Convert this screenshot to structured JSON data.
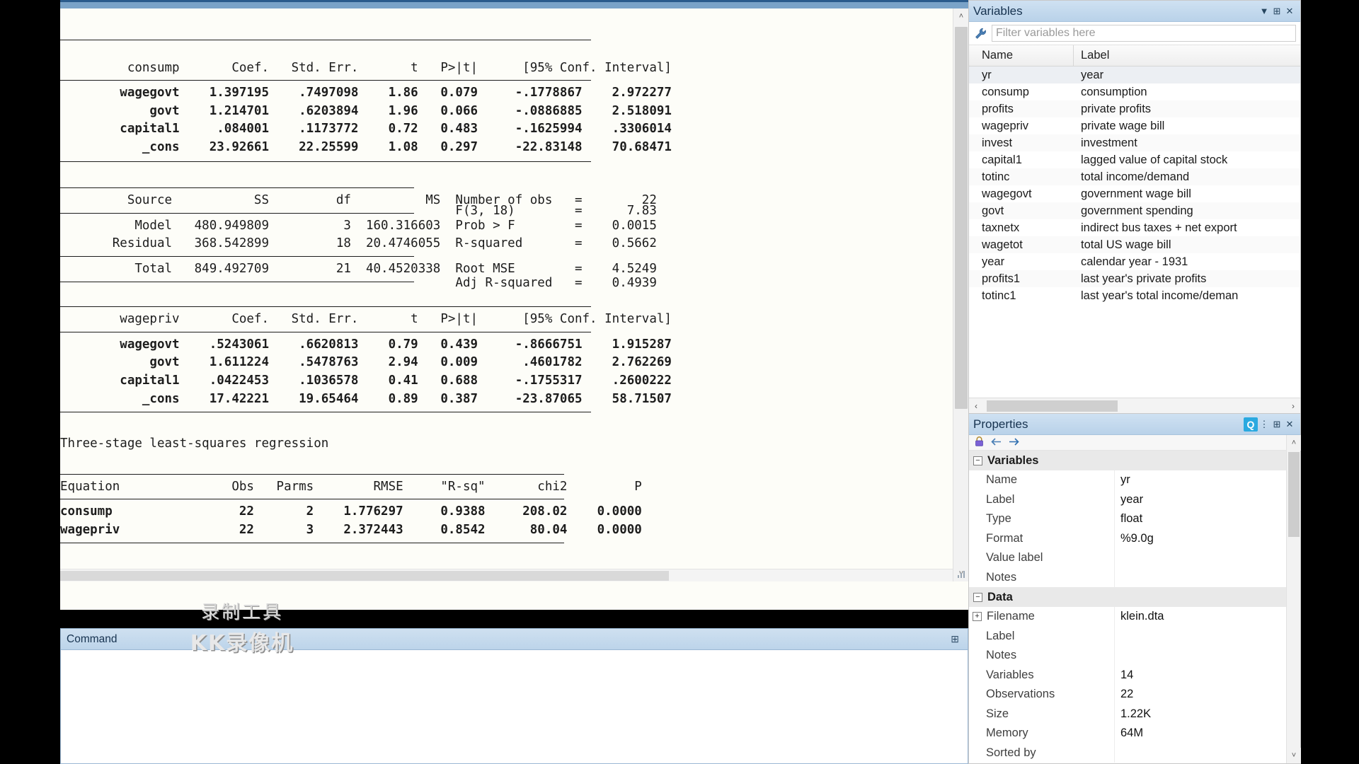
{
  "results": {
    "consump_table": {
      "dep_var": "consump",
      "columns": [
        "Coef.",
        "Std. Err.",
        "t",
        "P>|t|",
        "[95% Conf. Interval]"
      ],
      "rows": [
        {
          "term": "wagegovt",
          "coef": "1.397195",
          "se": ".7497098",
          "t": "1.86",
          "p": "0.079",
          "ci_low": "-.1778867",
          "ci_high": "2.972277"
        },
        {
          "term": "govt",
          "coef": "1.214701",
          "se": ".6203894",
          "t": "1.96",
          "p": "0.066",
          "ci_low": "-.0886885",
          "ci_high": "2.518091"
        },
        {
          "term": "capital1",
          "coef": ".084001",
          "se": ".1173772",
          "t": "0.72",
          "p": "0.483",
          "ci_low": "-.1625994",
          "ci_high": ".3306014"
        },
        {
          "term": "_cons",
          "coef": "23.92661",
          "se": "22.25599",
          "t": "1.08",
          "p": "0.297",
          "ci_low": "-22.83148",
          "ci_high": "70.68471"
        }
      ]
    },
    "anova_table": {
      "columns": [
        "Source",
        "SS",
        "df",
        "MS"
      ],
      "rows": [
        {
          "source": "Model",
          "ss": "480.949809",
          "df": "3",
          "ms": "160.316603"
        },
        {
          "source": "Residual",
          "ss": "368.542899",
          "df": "18",
          "ms": "20.4746055"
        },
        {
          "source": "Total",
          "ss": "849.492709",
          "df": "21",
          "ms": "40.4520338"
        }
      ],
      "stats": [
        {
          "label": "Number of obs",
          "eq": "=",
          "value": "22"
        },
        {
          "label": "F(3, 18)",
          "eq": "=",
          "value": "7.83"
        },
        {
          "label": "Prob > F",
          "eq": "=",
          "value": "0.0015"
        },
        {
          "label": "R-squared",
          "eq": "=",
          "value": "0.5662"
        },
        {
          "label": "Adj R-squared",
          "eq": "=",
          "value": "0.4939"
        },
        {
          "label": "Root MSE",
          "eq": "=",
          "value": "4.5249"
        }
      ]
    },
    "wagepriv_table": {
      "dep_var": "wagepriv",
      "columns": [
        "Coef.",
        "Std. Err.",
        "t",
        "P>|t|",
        "[95% Conf. Interval]"
      ],
      "rows": [
        {
          "term": "wagegovt",
          "coef": ".5243061",
          "se": ".6620813",
          "t": "0.79",
          "p": "0.439",
          "ci_low": "-.8666751",
          "ci_high": "1.915287"
        },
        {
          "term": "govt",
          "coef": "1.611224",
          "se": ".5478763",
          "t": "2.94",
          "p": "0.009",
          "ci_low": ".4601782",
          "ci_high": "2.762269"
        },
        {
          "term": "capital1",
          "coef": ".0422453",
          "se": ".1036578",
          "t": "0.41",
          "p": "0.688",
          "ci_low": "-.1755317",
          "ci_high": ".2600222"
        },
        {
          "term": "_cons",
          "coef": "17.42221",
          "se": "19.65464",
          "t": "0.89",
          "p": "0.387",
          "ci_low": "-23.87065",
          "ci_high": "58.71507"
        }
      ]
    },
    "reg3_title": "Three-stage least-squares regression",
    "reg3_table": {
      "columns": [
        "Equation",
        "Obs",
        "Parms",
        "RMSE",
        "\"R-sq\"",
        "chi2",
        "P"
      ],
      "rows": [
        {
          "equation": "consump",
          "obs": "22",
          "parms": "2",
          "rmse": "1.776297",
          "rsq": "0.9388",
          "chi2": "208.02",
          "p": "0.0000"
        },
        {
          "equation": "wagepriv",
          "obs": "22",
          "parms": "3",
          "rmse": "2.372443",
          "rsq": "0.8542",
          "chi2": "80.04",
          "p": "0.0000"
        }
      ]
    }
  },
  "command": {
    "title": "Command",
    "pin_icon": "pin-icon",
    "value": "",
    "placeholder": ""
  },
  "watermark": {
    "line1": "录制工具",
    "line2": "KK录像机"
  },
  "variables": {
    "title": "Variables",
    "title_buttons": [
      {
        "name": "filter-dropdown-icon",
        "glyph": "▼"
      },
      {
        "name": "pin-icon",
        "glyph": "⊞"
      },
      {
        "name": "close-icon",
        "glyph": "✕"
      }
    ],
    "filter": {
      "icon": "wrench-icon",
      "placeholder": "Filter variables here",
      "value": ""
    },
    "headers": [
      "Name",
      "Label"
    ],
    "rows": [
      {
        "name": "yr",
        "label": "year",
        "selected": true
      },
      {
        "name": "consump",
        "label": "consumption",
        "selected": false
      },
      {
        "name": "profits",
        "label": "private profits",
        "selected": false
      },
      {
        "name": "wagepriv",
        "label": "private wage bill",
        "selected": false
      },
      {
        "name": "invest",
        "label": "investment",
        "selected": false
      },
      {
        "name": "capital1",
        "label": "lagged value of capital stock",
        "selected": false
      },
      {
        "name": "totinc",
        "label": "total income/demand",
        "selected": false
      },
      {
        "name": "wagegovt",
        "label": "government wage bill",
        "selected": false
      },
      {
        "name": "govt",
        "label": "government spending",
        "selected": false
      },
      {
        "name": "taxnetx",
        "label": "indirect bus taxes + net export",
        "selected": false
      },
      {
        "name": "wagetot",
        "label": "total US wage bill",
        "selected": false
      },
      {
        "name": "year",
        "label": "calendar year - 1931",
        "selected": false
      },
      {
        "name": "profits1",
        "label": "last year's private profits",
        "selected": false
      },
      {
        "name": "totinc1",
        "label": "last year's total income/deman",
        "selected": false
      }
    ],
    "hscroll": {
      "left_arrow": "‹",
      "right_arrow": "›"
    }
  },
  "properties": {
    "title": "Properties",
    "title_buttons": [
      {
        "name": "quick-help-badge",
        "glyph": "Q"
      },
      {
        "name": "options-icon",
        "glyph": "⋮"
      },
      {
        "name": "pin-icon",
        "glyph": "⊞"
      },
      {
        "name": "close-icon",
        "glyph": "✕"
      }
    ],
    "toolbar": [
      {
        "name": "lock-icon",
        "glyph": "🔒"
      },
      {
        "name": "back-arrow-icon",
        "glyph": "←"
      },
      {
        "name": "forward-arrow-icon",
        "glyph": "→"
      }
    ],
    "groups": [
      {
        "name": "Variables",
        "rows": [
          {
            "key": "Name",
            "value": "yr",
            "expandable": false
          },
          {
            "key": "Label",
            "value": "year",
            "expandable": false
          },
          {
            "key": "Type",
            "value": "float",
            "expandable": false
          },
          {
            "key": "Format",
            "value": "%9.0g",
            "expandable": false
          },
          {
            "key": "Value label",
            "value": "",
            "expandable": false
          },
          {
            "key": "Notes",
            "value": "",
            "expandable": false
          }
        ]
      },
      {
        "name": "Data",
        "rows": [
          {
            "key": "Filename",
            "value": "klein.dta",
            "expandable": true
          },
          {
            "key": "Label",
            "value": "",
            "expandable": false
          },
          {
            "key": "Notes",
            "value": "",
            "expandable": false
          },
          {
            "key": "Variables",
            "value": "14",
            "expandable": false
          },
          {
            "key": "Observations",
            "value": "22",
            "expandable": false
          },
          {
            "key": "Size",
            "value": "1.22K",
            "expandable": false
          },
          {
            "key": "Memory",
            "value": "64M",
            "expandable": false
          },
          {
            "key": "Sorted by",
            "value": "",
            "expandable": false
          }
        ]
      }
    ]
  },
  "scrollbars": {
    "results_up": "˄",
    "results_down": "˅",
    "prop_up": "˄",
    "prop_down": "˅"
  },
  "colors": {
    "title_bar": "#bcd4ea",
    "panel_border": "#c8c8c8",
    "text": "#1d1d1d",
    "accent": "#2a5b8c",
    "selection": "#eceff3",
    "badge": "#2aa9e0"
  }
}
